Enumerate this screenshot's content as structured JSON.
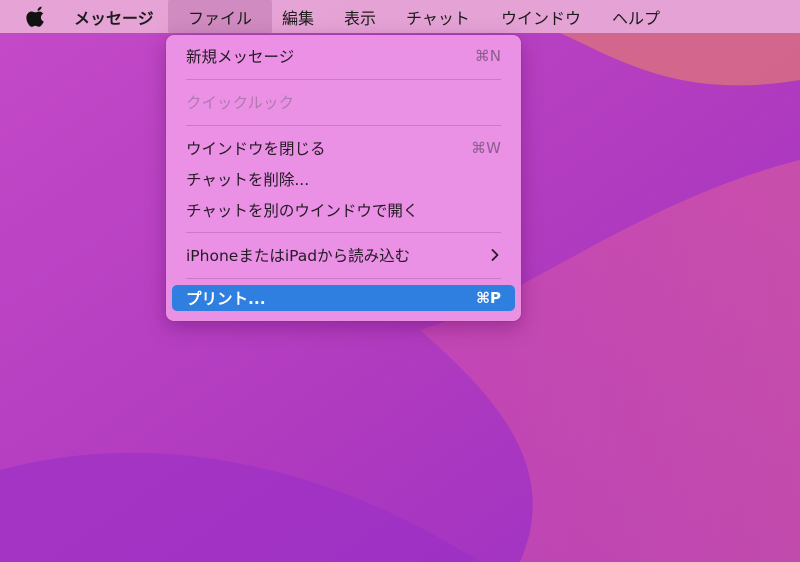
{
  "menubar": {
    "app_name": "メッセージ",
    "items": [
      "ファイル",
      "編集",
      "表示",
      "チャット",
      "ウインドウ",
      "ヘルプ"
    ]
  },
  "file_menu": {
    "items": [
      {
        "label": "新規メッセージ",
        "shortcut": "⌘N",
        "enabled": true
      },
      {
        "label": "クイックルック",
        "enabled": false
      },
      {
        "label": "ウインドウを閉じる",
        "shortcut": "⌘W",
        "enabled": true
      },
      {
        "label": "チャットを削除...",
        "enabled": true
      },
      {
        "label": "チャットを別のウインドウで開く",
        "enabled": true
      },
      {
        "label": "iPhoneまたはiPadから読み込む",
        "submenu": true,
        "enabled": true
      },
      {
        "label": "プリント...",
        "shortcut": "⌘P",
        "enabled": true,
        "highlighted": true
      }
    ]
  },
  "colors": {
    "selection": "#2f7fe0",
    "menu_background": "#ec94e6",
    "wallpaper": "#b43dbd"
  }
}
